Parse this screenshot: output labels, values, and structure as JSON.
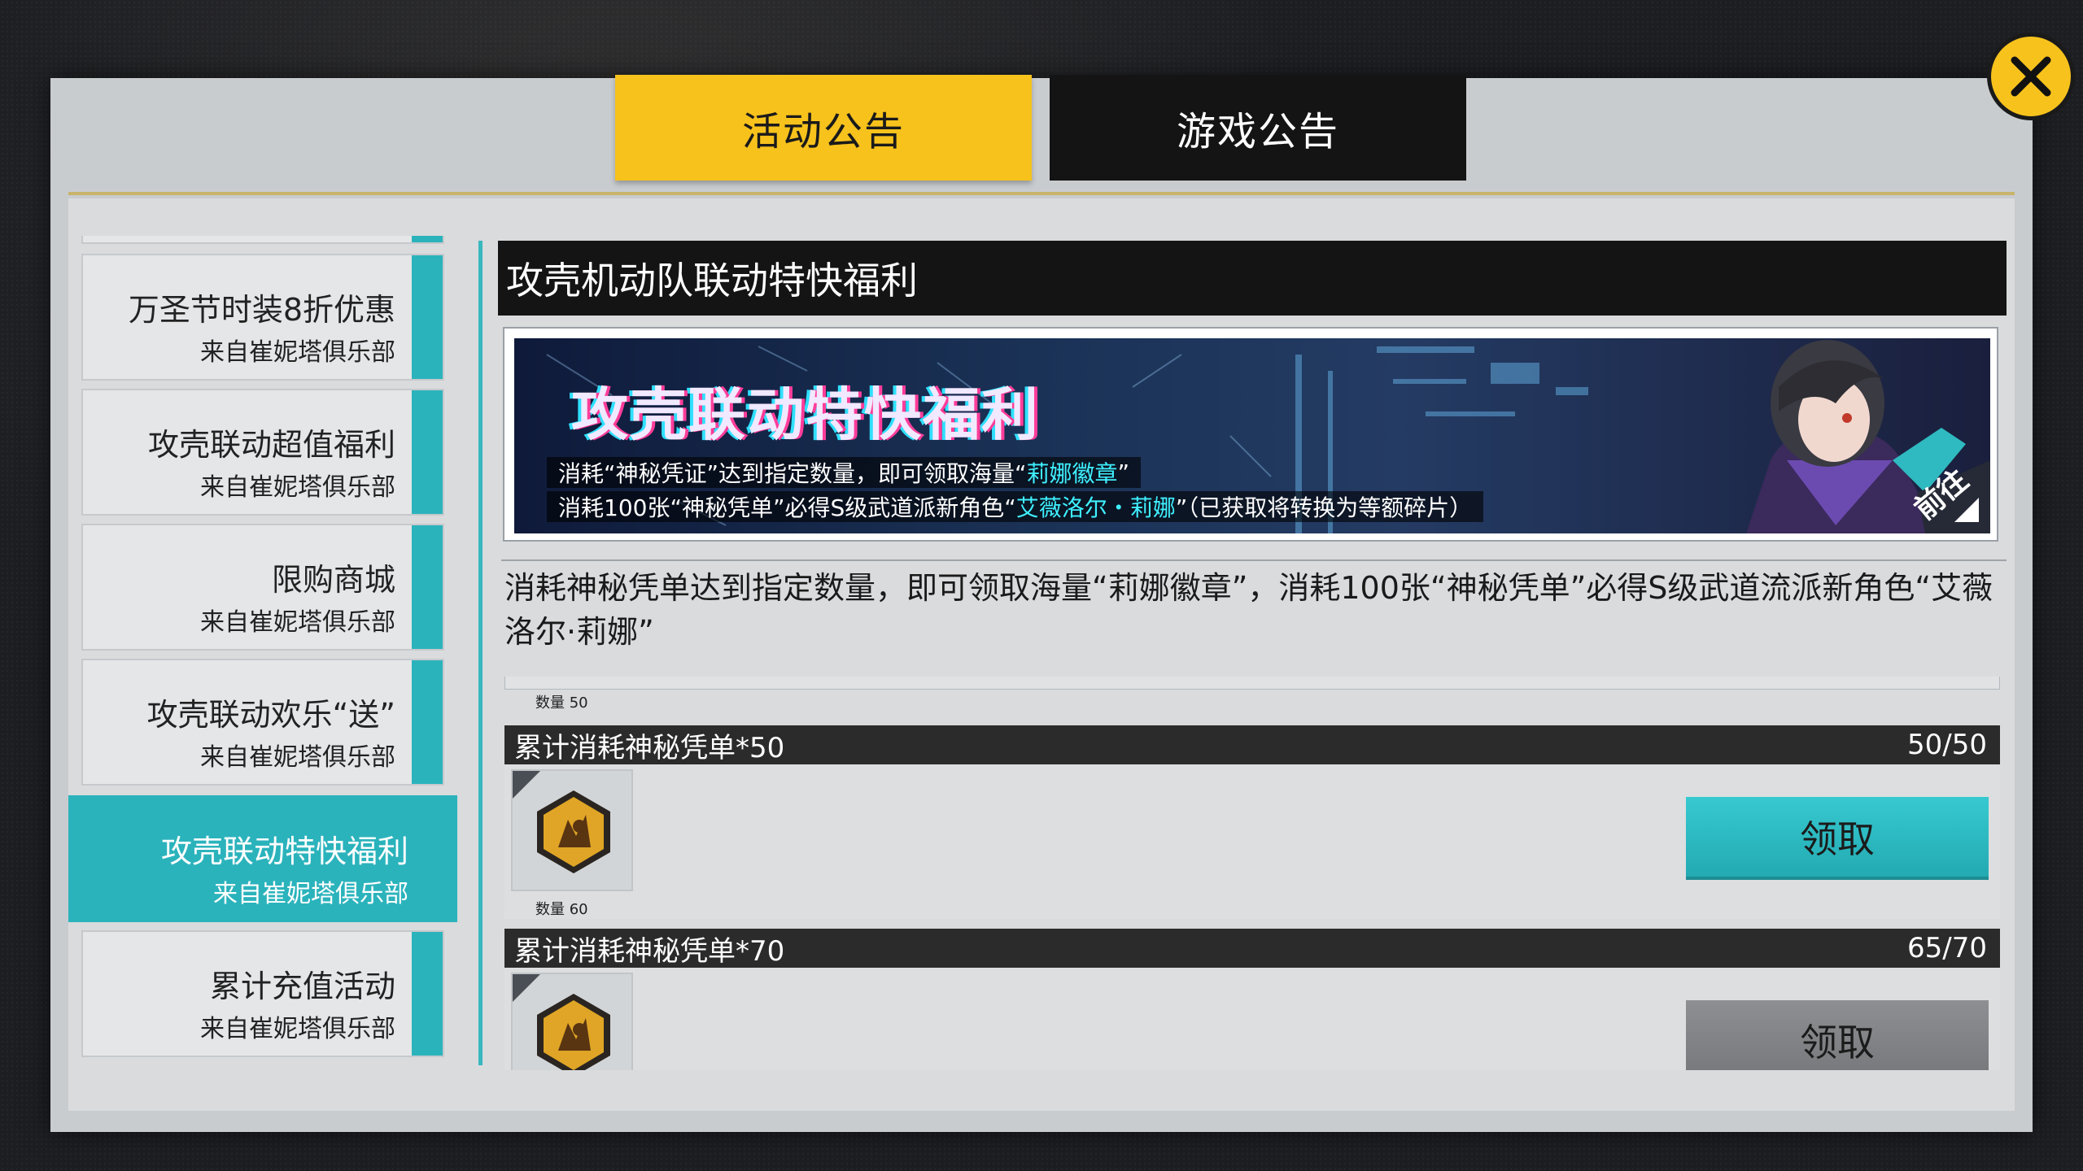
{
  "tabs": {
    "activity": "活动公告",
    "game": "游戏公告"
  },
  "close": {
    "icon": "close-icon"
  },
  "sidebar": {
    "items": [
      {
        "title": "万圣节时装8折优惠",
        "source": "来自崔妮塔俱乐部",
        "active": false
      },
      {
        "title": "攻壳联动超值福利",
        "source": "来自崔妮塔俱乐部",
        "active": false
      },
      {
        "title": "限购商城",
        "source": "来自崔妮塔俱乐部",
        "active": false
      },
      {
        "title": "攻壳联动欢乐“送”",
        "source": "来自崔妮塔俱乐部",
        "active": false
      },
      {
        "title": "攻壳联动特快福利",
        "source": "来自崔妮塔俱乐部",
        "active": true
      },
      {
        "title": "累计充值活动",
        "source": "来自崔妮塔俱乐部",
        "active": false
      }
    ]
  },
  "content": {
    "title": "攻壳机动队联动特快福利",
    "banner": {
      "title": "攻壳联动特快福利",
      "line1_prefix": "消耗“神秘凭证”达到指定数量，即可领取海量“",
      "line1_highlight": "莉娜徽章",
      "line1_suffix": "”",
      "line2_prefix": "消耗100张“神秘凭单”必得S级武道派新角色“",
      "line2_highlight": "艾薇洛尔・莉娜",
      "line2_suffix": "”（已获取将转换为等额碎片）",
      "goto": "前往"
    },
    "description": "消耗神秘凭单达到指定数量，即可领取海量“莉娜徽章”，消耗100张“神秘凭单”必得S级武道流派新角色“艾薇洛尔·莉娜”"
  },
  "tasks": [
    {
      "prev_qty": "数量 50",
      "name": "累计消耗神秘凭单*50",
      "progress": "50/50",
      "reward_qty": "数量 60",
      "claim": "领取",
      "claimable": true
    },
    {
      "name": "累计消耗神秘凭单*70",
      "progress": "65/70",
      "claim": "领取",
      "claimable": false
    }
  ],
  "colors": {
    "accent_gold": "#f7c21c",
    "accent_teal": "#2bb3bc",
    "dark": "#141414",
    "disabled": "#7f8184"
  }
}
